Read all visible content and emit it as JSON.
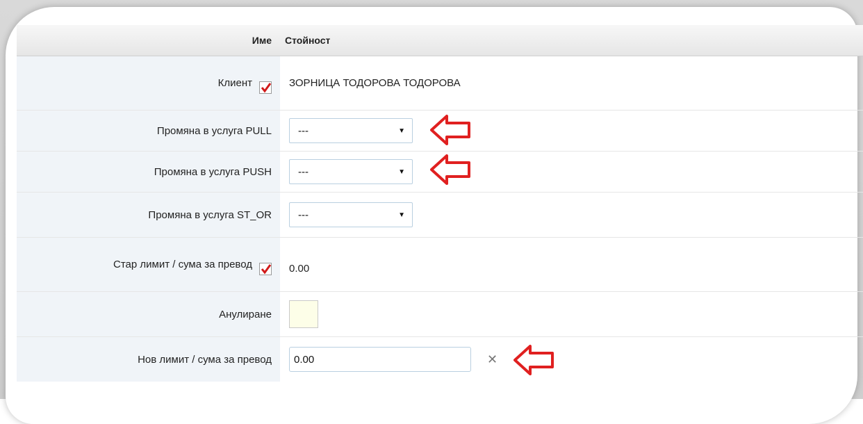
{
  "table": {
    "header": {
      "name": "Име",
      "value": "Стойност"
    },
    "rows": [
      {
        "label": "Клиент",
        "value": "ЗОРНИЦА ТОДОРОВА ТОДОРОВА"
      },
      {
        "label": "Промяна в услуга PULL",
        "selected": "---"
      },
      {
        "label": "Промяна в услуга PUSH",
        "selected": "---"
      },
      {
        "label": "Промяна в услуга ST_OR",
        "selected": "---"
      },
      {
        "label": "Стар лимит / сума за превод",
        "value": "0.00"
      },
      {
        "label": "Анулиране"
      },
      {
        "label": "Нов лимит / сума за превод",
        "input_value": "0.00"
      }
    ]
  },
  "icons": {
    "checkbox": "checkbox-checked-icon",
    "caret": "caret-down-icon",
    "clear": "clear-x-icon",
    "arrow": "left-arrow-annotation-icon"
  },
  "colors": {
    "label_bg": "#f0f4f8",
    "annotation_red": "#e02020",
    "check_red": "#d11a1a",
    "cancel_bg": "#fdfee8"
  }
}
